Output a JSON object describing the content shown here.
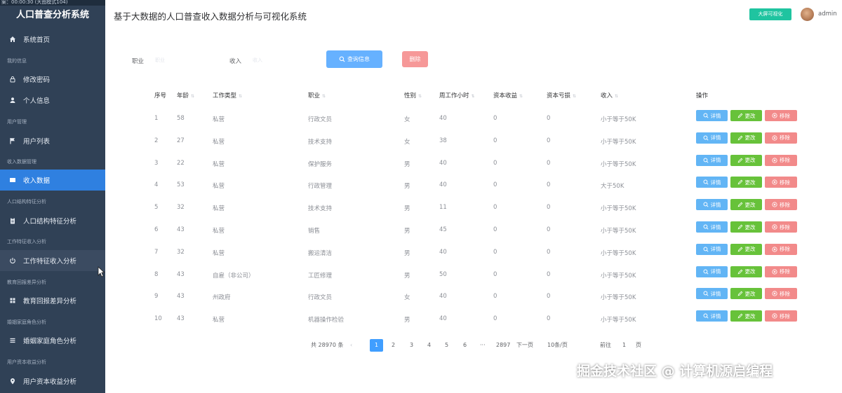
{
  "overlay": {
    "text": "案：00:00:30 (大图模式104)"
  },
  "app": {
    "logo": "人口普查分析系统",
    "title": "基于大数据的人口普查收入数据分析与可视化系统"
  },
  "header": {
    "bigscreen_label": "大屏可视化",
    "username": "admin"
  },
  "sidebar": {
    "items": [
      {
        "label": "系统首页",
        "icon": "home-icon"
      },
      {
        "group": "我的信息"
      },
      {
        "label": "修改密码",
        "icon": "lock-icon"
      },
      {
        "label": "个人信息",
        "icon": "user-icon"
      },
      {
        "group": "用户管理"
      },
      {
        "label": "用户列表",
        "icon": "flag-icon"
      },
      {
        "group": "收入数据管理"
      },
      {
        "label": "收入数据",
        "icon": "monitor-icon"
      },
      {
        "group": "人口结构特征分析"
      },
      {
        "label": "人口结构特征分析",
        "icon": "clipboard-icon"
      },
      {
        "group": "工作特征收入分析"
      },
      {
        "label": "工作特征收入分析",
        "icon": "power-icon"
      },
      {
        "group": "教育回报差异分析"
      },
      {
        "label": "教育回报差异分析",
        "icon": "grid-icon"
      },
      {
        "group": "婚姻家庭角色分析"
      },
      {
        "label": "婚姻家庭角色分析",
        "icon": "list-icon"
      },
      {
        "group": "用户资本收益分析"
      },
      {
        "label": "用户资本收益分析",
        "icon": "location-icon"
      }
    ]
  },
  "filters": {
    "job_label": "职业",
    "job_placeholder": "职业",
    "income_label": "收入",
    "income_placeholder": "收入",
    "search_label": "查询信息",
    "delete_label": "删除"
  },
  "table": {
    "headers": [
      "序号",
      "年龄",
      "工作类型",
      "职业",
      "性别",
      "周工作小时",
      "资本收益",
      "资本亏损",
      "收入",
      "操作"
    ],
    "op_labels": {
      "detail": "详情",
      "edit": "更改",
      "remove": "移除"
    },
    "rows": [
      [
        "1",
        "58",
        "私营",
        "行政文员",
        "女",
        "40",
        "0",
        "0",
        "小于等于50K"
      ],
      [
        "2",
        "27",
        "私营",
        "技术支持",
        "女",
        "38",
        "0",
        "0",
        "小于等于50K"
      ],
      [
        "3",
        "22",
        "私营",
        "保护服务",
        "男",
        "40",
        "0",
        "0",
        "小于等于50K"
      ],
      [
        "4",
        "53",
        "私营",
        "行政管理",
        "男",
        "40",
        "0",
        "0",
        "大于50K"
      ],
      [
        "5",
        "32",
        "私营",
        "技术支持",
        "男",
        "11",
        "0",
        "0",
        "小于等于50K"
      ],
      [
        "6",
        "43",
        "私营",
        "销售",
        "男",
        "45",
        "0",
        "0",
        "小于等于50K"
      ],
      [
        "7",
        "32",
        "私营",
        "搬运清洁",
        "男",
        "40",
        "0",
        "0",
        "小于等于50K"
      ],
      [
        "8",
        "43",
        "自雇（非公司）",
        "工匠修理",
        "男",
        "50",
        "0",
        "0",
        "小于等于50K"
      ],
      [
        "9",
        "43",
        "州政府",
        "行政文员",
        "女",
        "40",
        "0",
        "0",
        "小于等于50K"
      ],
      [
        "10",
        "43",
        "私营",
        "机器操作检验",
        "男",
        "40",
        "0",
        "0",
        "小于等于50K"
      ]
    ]
  },
  "pagination": {
    "total": "共 28970 条",
    "pages": [
      "1",
      "2",
      "3",
      "4",
      "5",
      "6"
    ],
    "ellipsis": "···",
    "last": "2897",
    "next": "下一页",
    "page_size": "10条/页",
    "goto_prefix": "前往",
    "goto_value": "1",
    "goto_suffix": "页"
  },
  "watermark": {
    "text": "掘金技术社区 @ 计算机源启编程"
  },
  "colors": {
    "sidebar_bg": "#304156",
    "active": "#2f80e0",
    "primary": "#409eff",
    "success": "#67c23a",
    "danger": "#f28a8a",
    "bigscreen": "#1fc4a0"
  }
}
